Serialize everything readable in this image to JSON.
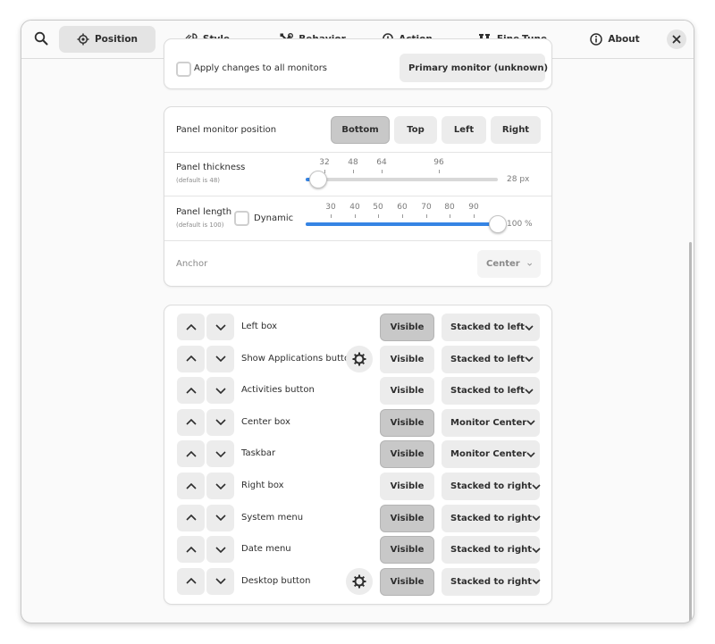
{
  "header": {
    "search_icon": "search-icon",
    "close_icon": "close-icon",
    "tabs": [
      {
        "label": "Position",
        "icon": "position-icon",
        "active": true
      },
      {
        "label": "Style",
        "icon": "style-icon",
        "active": false
      },
      {
        "label": "Behavior",
        "icon": "behavior-icon",
        "active": false
      },
      {
        "label": "Action",
        "icon": "action-icon",
        "active": false
      },
      {
        "label": "Fine-Tune",
        "icon": "fine-tune-icon",
        "active": false
      },
      {
        "label": "About",
        "icon": "about-icon",
        "active": false
      }
    ]
  },
  "monitor": {
    "apply_all_label": "Apply changes to all monitors",
    "apply_all_checked": false,
    "monitor_select": "Primary monitor (unknown)"
  },
  "panel": {
    "position_label": "Panel monitor position",
    "positions": [
      "Bottom",
      "Top",
      "Left",
      "Right"
    ],
    "selected_position": "Bottom",
    "thickness_label": "Panel thickness",
    "thickness_default": "(default is 48)",
    "thickness_ticks": [
      "32",
      "48",
      "64",
      "96"
    ],
    "thickness_value": "28 px",
    "length_label": "Panel length",
    "length_default": "(default is 100)",
    "dynamic_label": "Dynamic",
    "dynamic_checked": false,
    "length_ticks": [
      "30",
      "40",
      "50",
      "60",
      "70",
      "80",
      "90"
    ],
    "length_value": "100 %",
    "anchor_label": "Anchor",
    "anchor_value": "Center"
  },
  "elements": {
    "rows": [
      {
        "label": "Left box",
        "visible": "Visible",
        "visible_on": true,
        "position": "Stacked to left",
        "gear": false
      },
      {
        "label": "Show Applications button",
        "visible": "Visible",
        "visible_on": false,
        "position": "Stacked to left",
        "gear": true
      },
      {
        "label": "Activities button",
        "visible": "Visible",
        "visible_on": false,
        "position": "Stacked to left",
        "gear": false
      },
      {
        "label": "Center box",
        "visible": "Visible",
        "visible_on": true,
        "position": "Monitor Center",
        "gear": false
      },
      {
        "label": "Taskbar",
        "visible": "Visible",
        "visible_on": true,
        "position": "Monitor Center",
        "gear": false
      },
      {
        "label": "Right box",
        "visible": "Visible",
        "visible_on": false,
        "position": "Stacked to right",
        "gear": false
      },
      {
        "label": "System menu",
        "visible": "Visible",
        "visible_on": true,
        "position": "Stacked to right",
        "gear": false
      },
      {
        "label": "Date menu",
        "visible": "Visible",
        "visible_on": true,
        "position": "Stacked to right",
        "gear": false
      },
      {
        "label": "Desktop button",
        "visible": "Visible",
        "visible_on": true,
        "position": "Stacked to right",
        "gear": true
      }
    ]
  },
  "colors": {
    "accent": "#3584e4",
    "pressed": "#c8c8c8",
    "button": "#ececec"
  }
}
